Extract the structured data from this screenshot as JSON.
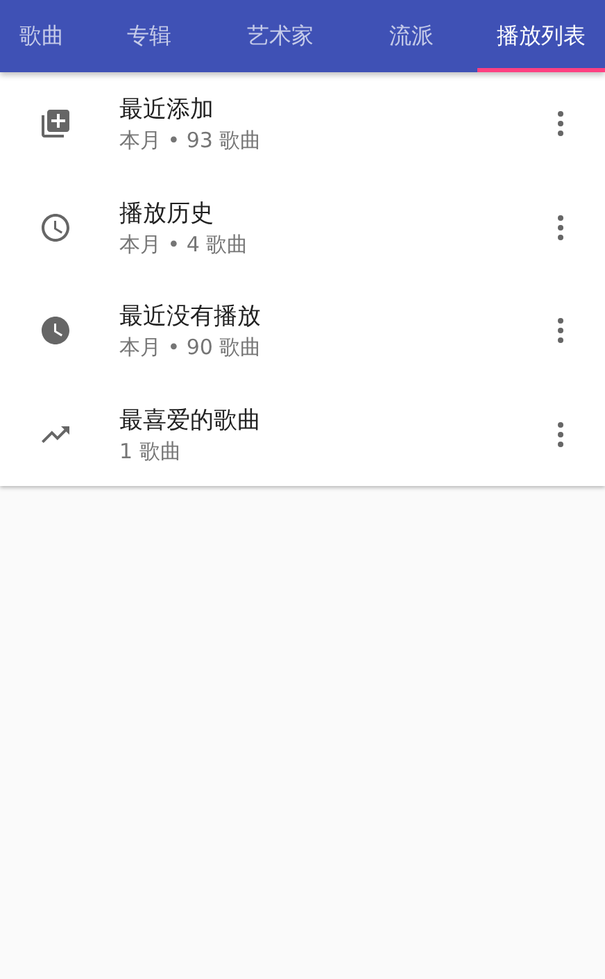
{
  "tabs": [
    {
      "label": "歌曲",
      "selected": false
    },
    {
      "label": "专辑",
      "selected": false
    },
    {
      "label": "艺术家",
      "selected": false
    },
    {
      "label": "流派",
      "selected": false
    },
    {
      "label": "播放列表",
      "selected": true
    }
  ],
  "playlists": [
    {
      "kind": "added",
      "title": "最近添加",
      "subtitle": "本月 • 93 歌曲"
    },
    {
      "kind": "history",
      "title": "播放历史",
      "subtitle": "本月 • 4 歌曲"
    },
    {
      "kind": "unplayed",
      "title": "最近没有播放",
      "subtitle": "本月 • 90 歌曲"
    },
    {
      "kind": "trending",
      "title": "最喜爱的歌曲",
      "subtitle": "1 歌曲"
    }
  ]
}
